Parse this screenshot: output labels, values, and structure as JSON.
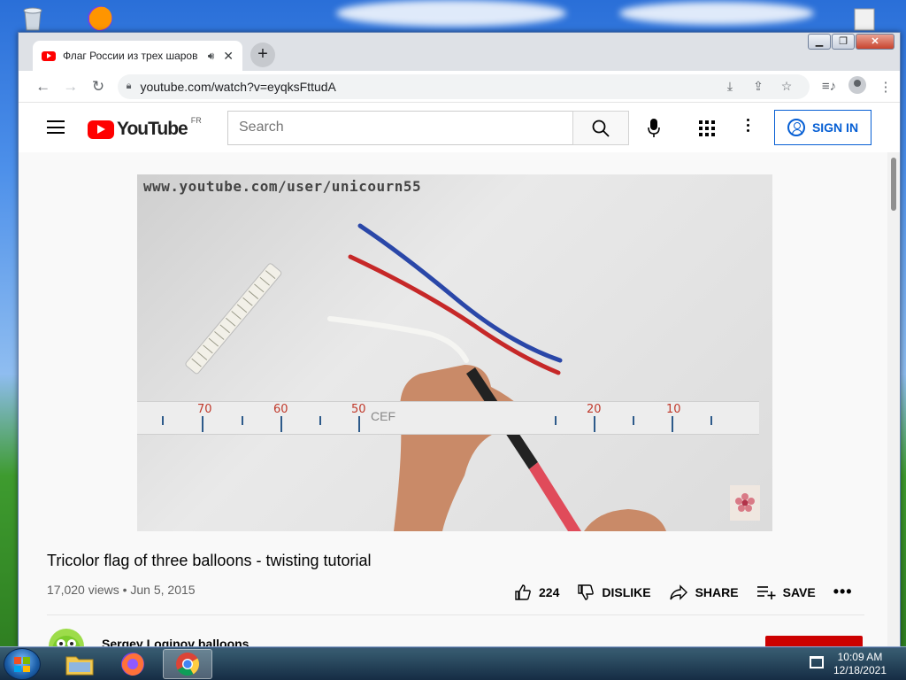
{
  "browser": {
    "tab_title": "Флаг России из трех шаров",
    "url": "youtube.com/watch?v=eyqksFttudA"
  },
  "youtube": {
    "logo_text": "YouTube",
    "region": "FR",
    "search_placeholder": "Search",
    "sign_in": "SIGN IN"
  },
  "video": {
    "watermark": "www.youtube.com/user/unicourn55",
    "ruler_numbers": [
      "70",
      "60",
      "50",
      "20",
      "10"
    ],
    "ruler_text": "CEF",
    "title": "Tricolor flag of three balloons - twisting tutorial",
    "meta": "17,020 views • Jun 5, 2015",
    "likes": "224",
    "dislike_label": "DISLIKE",
    "share_label": "SHARE",
    "save_label": "SAVE"
  },
  "channel": {
    "name": "Sergey Loginov balloons"
  },
  "taskbar": {
    "time": "10:09 AM",
    "date": "12/18/2021"
  }
}
